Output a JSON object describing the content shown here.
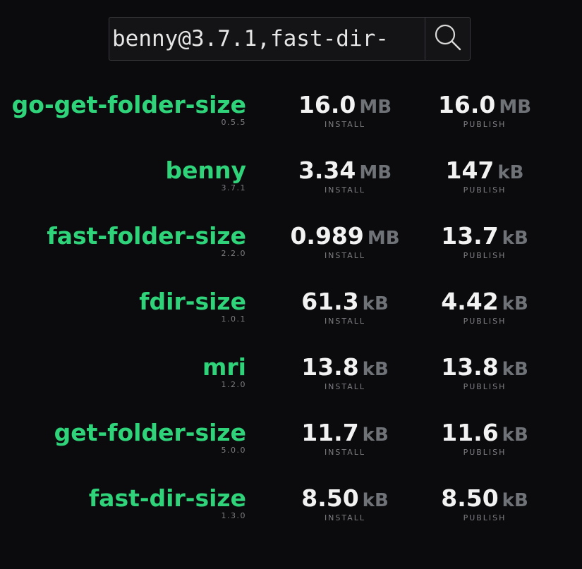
{
  "search": {
    "value": "benny@3.7.1,fast-dir-",
    "button_icon": "search-icon"
  },
  "labels": {
    "install": "INSTALL",
    "publish": "PUBLISH"
  },
  "colors": {
    "package_name": "#2fd37a",
    "value": "#f2f2f2",
    "unit": "#6f7377",
    "background": "#0b0b0d"
  },
  "packages": [
    {
      "name": "go-get-folder-size",
      "version": "0.5.5",
      "install_value": "16.0",
      "install_unit": "MB",
      "publish_value": "16.0",
      "publish_unit": "MB"
    },
    {
      "name": "benny",
      "version": "3.7.1",
      "install_value": "3.34",
      "install_unit": "MB",
      "publish_value": "147",
      "publish_unit": "kB"
    },
    {
      "name": "fast-folder-size",
      "version": "2.2.0",
      "install_value": "0.989",
      "install_unit": "MB",
      "publish_value": "13.7",
      "publish_unit": "kB"
    },
    {
      "name": "fdir-size",
      "version": "1.0.1",
      "install_value": "61.3",
      "install_unit": "kB",
      "publish_value": "4.42",
      "publish_unit": "kB"
    },
    {
      "name": "mri",
      "version": "1.2.0",
      "install_value": "13.8",
      "install_unit": "kB",
      "publish_value": "13.8",
      "publish_unit": "kB"
    },
    {
      "name": "get-folder-size",
      "version": "5.0.0",
      "install_value": "11.7",
      "install_unit": "kB",
      "publish_value": "11.6",
      "publish_unit": "kB"
    },
    {
      "name": "fast-dir-size",
      "version": "1.3.0",
      "install_value": "8.50",
      "install_unit": "kB",
      "publish_value": "8.50",
      "publish_unit": "kB"
    }
  ]
}
